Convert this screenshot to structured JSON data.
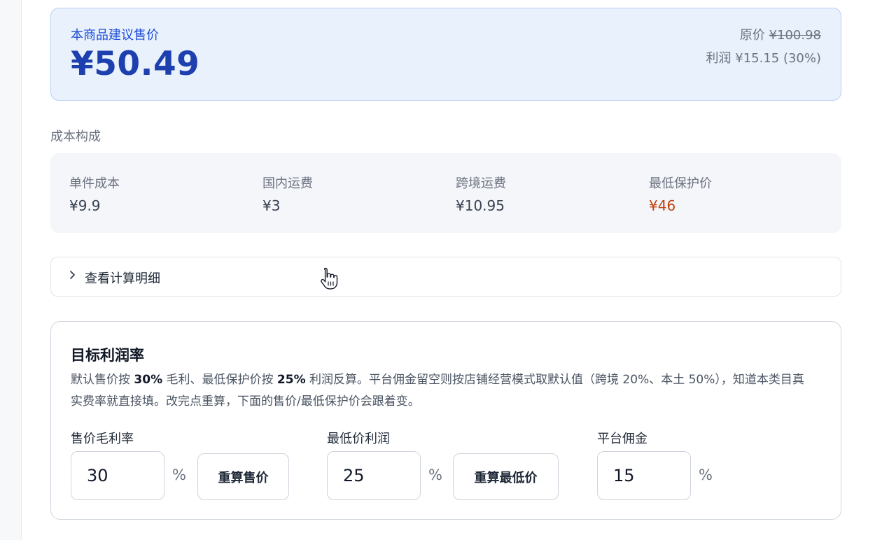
{
  "price_card": {
    "label": "本商品建议售价",
    "value": "¥50.49",
    "original_label": "原价",
    "original_value": "¥100.98",
    "profit_text": "利润 ¥15.15 (30%)"
  },
  "cost_section": {
    "title": "成本构成",
    "items": [
      {
        "name": "单件成本",
        "value": "¥9.9"
      },
      {
        "name": "国内运费",
        "value": "¥3"
      },
      {
        "name": "跨境运费",
        "value": "¥10.95"
      },
      {
        "name": "最低保护价",
        "value": "¥46"
      }
    ]
  },
  "details": {
    "label": "查看计算明细"
  },
  "target": {
    "title": "目标利润率",
    "desc_1": "默认售价按 ",
    "desc_b1": "30%",
    "desc_2": " 毛利、最低保护价按 ",
    "desc_b2": "25%",
    "desc_3": " 利润反算。平台佣金留空则按店铺经营模式取默认值（跨境 20%、本土 50%），知道本类目真实费率就直接填。改完点重算，下面的售价/最低保护价会跟着变。",
    "fields": {
      "gross_margin": {
        "label": "售价毛利率",
        "value": "30",
        "unit": "%",
        "button": "重算售价"
      },
      "min_profit": {
        "label": "最低价利润",
        "value": "25",
        "unit": "%",
        "button": "重算最低价"
      },
      "commission": {
        "label": "平台佣金",
        "value": "15",
        "unit": "%"
      }
    }
  },
  "colors": {
    "accent": "#1d4ed8",
    "price": "#1e40af",
    "warning": "#c2410c"
  }
}
